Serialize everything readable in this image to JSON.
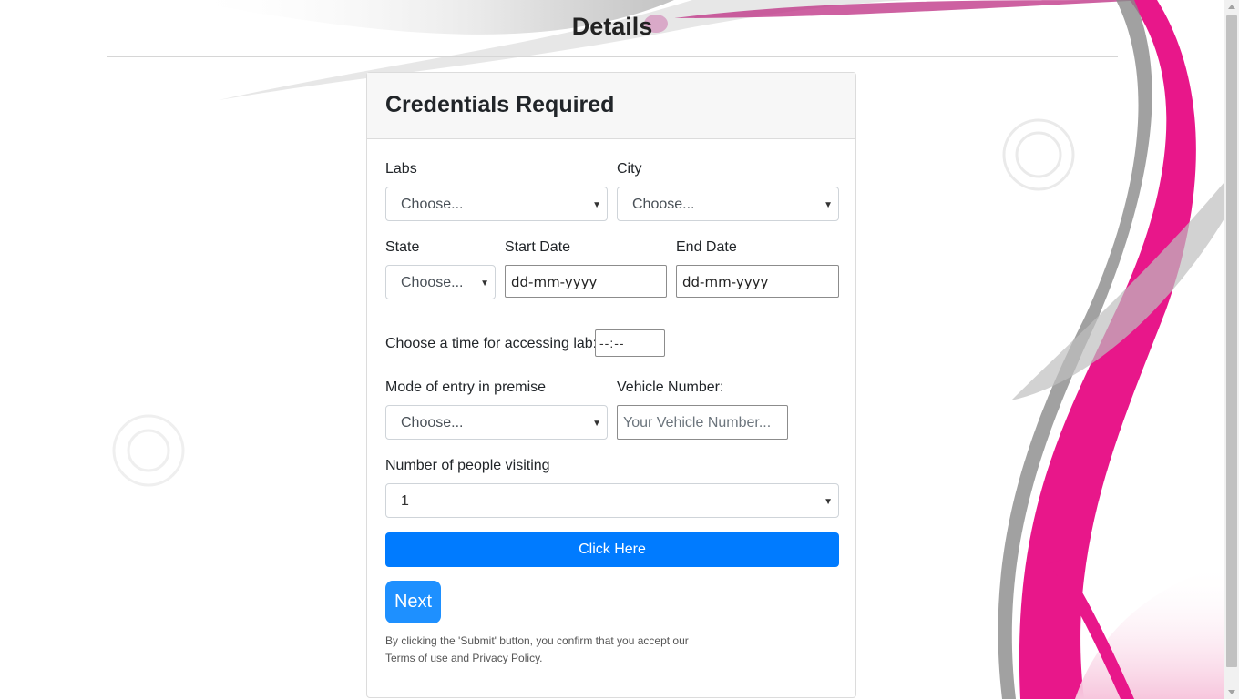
{
  "page": {
    "title": "Details",
    "accent_pink": "#e8178a",
    "accent_blue": "#007bff"
  },
  "card": {
    "title": "Credentials Required",
    "labs": {
      "label": "Labs",
      "value": "Choose..."
    },
    "city": {
      "label": "City",
      "value": "Choose..."
    },
    "state": {
      "label": "State",
      "value": "Choose..."
    },
    "start_date": {
      "label": "Start Date",
      "value": "dd-mm-yyyy"
    },
    "end_date": {
      "label": "End Date",
      "value": "dd-mm-yyyy"
    },
    "time": {
      "label": "Choose a time for accessing lab:",
      "value": "--:--"
    },
    "mode_of_entry": {
      "label": "Mode of entry in premise",
      "value": "Choose..."
    },
    "vehicle": {
      "label": "Vehicle Number:",
      "placeholder": "Your Vehicle Number..."
    },
    "people": {
      "label": "Number of people visiting",
      "value": "1"
    },
    "click_button": "Click Here",
    "next_button": "Next",
    "disclaimer_line1": "By clicking the 'Submit' button, you confirm that you accept our",
    "disclaimer_line2": "Terms of use and Privacy Policy."
  },
  "icons": {
    "caret": "caret-down-icon"
  }
}
